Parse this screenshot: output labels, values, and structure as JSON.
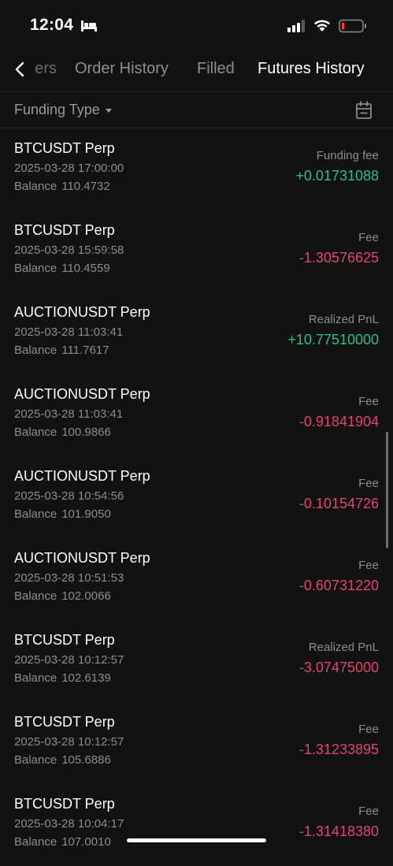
{
  "status_bar": {
    "time": "12:04"
  },
  "tabs": {
    "partial_label": "ers",
    "order_history": "Order History",
    "filled": "Filled",
    "futures_history": "Futures History"
  },
  "filter": {
    "label": "Funding Type"
  },
  "colors": {
    "positive": "#2ebd85",
    "negative": "#e2466b",
    "background": "#121212"
  },
  "records": [
    {
      "symbol": "BTCUSDT Perp",
      "time": "2025-03-28 17:00:00",
      "balance_label": "Balance",
      "balance": "110.4732",
      "type": "Funding fee",
      "amount": "+0.01731088",
      "sign": "pos"
    },
    {
      "symbol": "BTCUSDT Perp",
      "time": "2025-03-28 15:59:58",
      "balance_label": "Balance",
      "balance": "110.4559",
      "type": "Fee",
      "amount": "-1.30576625",
      "sign": "neg"
    },
    {
      "symbol": "AUCTIONUSDT Perp",
      "time": "2025-03-28 11:03:41",
      "balance_label": "Balance",
      "balance": "111.7617",
      "type": "Realized PnL",
      "amount": "+10.77510000",
      "sign": "pos"
    },
    {
      "symbol": "AUCTIONUSDT Perp",
      "time": "2025-03-28 11:03:41",
      "balance_label": "Balance",
      "balance": "100.9866",
      "type": "Fee",
      "amount": "-0.91841904",
      "sign": "neg"
    },
    {
      "symbol": "AUCTIONUSDT Perp",
      "time": "2025-03-28 10:54:56",
      "balance_label": "Balance",
      "balance": "101.9050",
      "type": "Fee",
      "amount": "-0.10154726",
      "sign": "neg"
    },
    {
      "symbol": "AUCTIONUSDT Perp",
      "time": "2025-03-28 10:51:53",
      "balance_label": "Balance",
      "balance": "102.0066",
      "type": "Fee",
      "amount": "-0.60731220",
      "sign": "neg"
    },
    {
      "symbol": "BTCUSDT Perp",
      "time": "2025-03-28 10:12:57",
      "balance_label": "Balance",
      "balance": "102.6139",
      "type": "Realized PnL",
      "amount": "-3.07475000",
      "sign": "neg"
    },
    {
      "symbol": "BTCUSDT Perp",
      "time": "2025-03-28 10:12:57",
      "balance_label": "Balance",
      "balance": "105.6886",
      "type": "Fee",
      "amount": "-1.31233895",
      "sign": "neg"
    },
    {
      "symbol": "BTCUSDT Perp",
      "time": "2025-03-28 10:04:17",
      "balance_label": "Balance",
      "balance": "107.0010",
      "type": "Fee",
      "amount": "-1.31418380",
      "sign": "neg"
    }
  ]
}
